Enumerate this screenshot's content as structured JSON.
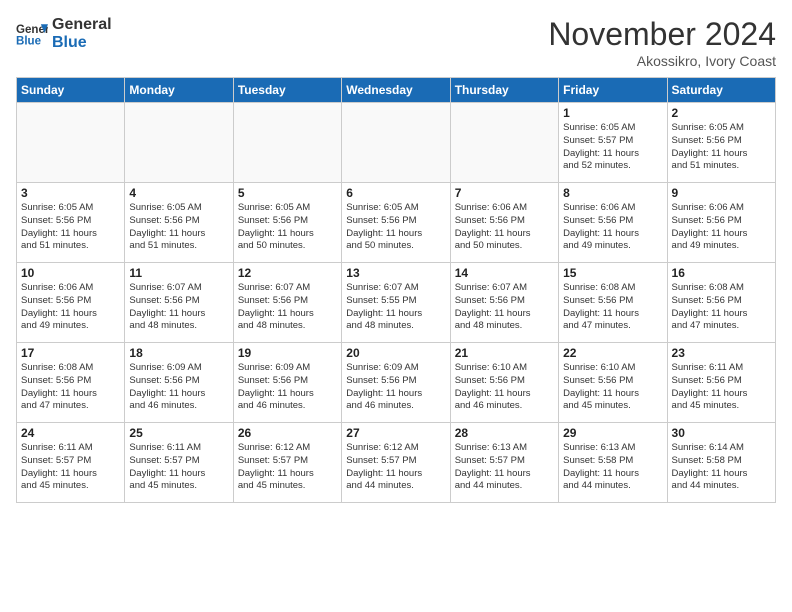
{
  "header": {
    "logo_line1": "General",
    "logo_line2": "Blue",
    "month": "November 2024",
    "location": "Akossikro, Ivory Coast"
  },
  "weekdays": [
    "Sunday",
    "Monday",
    "Tuesday",
    "Wednesday",
    "Thursday",
    "Friday",
    "Saturday"
  ],
  "weeks": [
    [
      {
        "day": "",
        "info": ""
      },
      {
        "day": "",
        "info": ""
      },
      {
        "day": "",
        "info": ""
      },
      {
        "day": "",
        "info": ""
      },
      {
        "day": "",
        "info": ""
      },
      {
        "day": "1",
        "info": "Sunrise: 6:05 AM\nSunset: 5:57 PM\nDaylight: 11 hours\nand 52 minutes."
      },
      {
        "day": "2",
        "info": "Sunrise: 6:05 AM\nSunset: 5:56 PM\nDaylight: 11 hours\nand 51 minutes."
      }
    ],
    [
      {
        "day": "3",
        "info": "Sunrise: 6:05 AM\nSunset: 5:56 PM\nDaylight: 11 hours\nand 51 minutes."
      },
      {
        "day": "4",
        "info": "Sunrise: 6:05 AM\nSunset: 5:56 PM\nDaylight: 11 hours\nand 51 minutes."
      },
      {
        "day": "5",
        "info": "Sunrise: 6:05 AM\nSunset: 5:56 PM\nDaylight: 11 hours\nand 50 minutes."
      },
      {
        "day": "6",
        "info": "Sunrise: 6:05 AM\nSunset: 5:56 PM\nDaylight: 11 hours\nand 50 minutes."
      },
      {
        "day": "7",
        "info": "Sunrise: 6:06 AM\nSunset: 5:56 PM\nDaylight: 11 hours\nand 50 minutes."
      },
      {
        "day": "8",
        "info": "Sunrise: 6:06 AM\nSunset: 5:56 PM\nDaylight: 11 hours\nand 49 minutes."
      },
      {
        "day": "9",
        "info": "Sunrise: 6:06 AM\nSunset: 5:56 PM\nDaylight: 11 hours\nand 49 minutes."
      }
    ],
    [
      {
        "day": "10",
        "info": "Sunrise: 6:06 AM\nSunset: 5:56 PM\nDaylight: 11 hours\nand 49 minutes."
      },
      {
        "day": "11",
        "info": "Sunrise: 6:07 AM\nSunset: 5:56 PM\nDaylight: 11 hours\nand 48 minutes."
      },
      {
        "day": "12",
        "info": "Sunrise: 6:07 AM\nSunset: 5:56 PM\nDaylight: 11 hours\nand 48 minutes."
      },
      {
        "day": "13",
        "info": "Sunrise: 6:07 AM\nSunset: 5:55 PM\nDaylight: 11 hours\nand 48 minutes."
      },
      {
        "day": "14",
        "info": "Sunrise: 6:07 AM\nSunset: 5:56 PM\nDaylight: 11 hours\nand 48 minutes."
      },
      {
        "day": "15",
        "info": "Sunrise: 6:08 AM\nSunset: 5:56 PM\nDaylight: 11 hours\nand 47 minutes."
      },
      {
        "day": "16",
        "info": "Sunrise: 6:08 AM\nSunset: 5:56 PM\nDaylight: 11 hours\nand 47 minutes."
      }
    ],
    [
      {
        "day": "17",
        "info": "Sunrise: 6:08 AM\nSunset: 5:56 PM\nDaylight: 11 hours\nand 47 minutes."
      },
      {
        "day": "18",
        "info": "Sunrise: 6:09 AM\nSunset: 5:56 PM\nDaylight: 11 hours\nand 46 minutes."
      },
      {
        "day": "19",
        "info": "Sunrise: 6:09 AM\nSunset: 5:56 PM\nDaylight: 11 hours\nand 46 minutes."
      },
      {
        "day": "20",
        "info": "Sunrise: 6:09 AM\nSunset: 5:56 PM\nDaylight: 11 hours\nand 46 minutes."
      },
      {
        "day": "21",
        "info": "Sunrise: 6:10 AM\nSunset: 5:56 PM\nDaylight: 11 hours\nand 46 minutes."
      },
      {
        "day": "22",
        "info": "Sunrise: 6:10 AM\nSunset: 5:56 PM\nDaylight: 11 hours\nand 45 minutes."
      },
      {
        "day": "23",
        "info": "Sunrise: 6:11 AM\nSunset: 5:56 PM\nDaylight: 11 hours\nand 45 minutes."
      }
    ],
    [
      {
        "day": "24",
        "info": "Sunrise: 6:11 AM\nSunset: 5:57 PM\nDaylight: 11 hours\nand 45 minutes."
      },
      {
        "day": "25",
        "info": "Sunrise: 6:11 AM\nSunset: 5:57 PM\nDaylight: 11 hours\nand 45 minutes."
      },
      {
        "day": "26",
        "info": "Sunrise: 6:12 AM\nSunset: 5:57 PM\nDaylight: 11 hours\nand 45 minutes."
      },
      {
        "day": "27",
        "info": "Sunrise: 6:12 AM\nSunset: 5:57 PM\nDaylight: 11 hours\nand 44 minutes."
      },
      {
        "day": "28",
        "info": "Sunrise: 6:13 AM\nSunset: 5:57 PM\nDaylight: 11 hours\nand 44 minutes."
      },
      {
        "day": "29",
        "info": "Sunrise: 6:13 AM\nSunset: 5:58 PM\nDaylight: 11 hours\nand 44 minutes."
      },
      {
        "day": "30",
        "info": "Sunrise: 6:14 AM\nSunset: 5:58 PM\nDaylight: 11 hours\nand 44 minutes."
      }
    ]
  ]
}
